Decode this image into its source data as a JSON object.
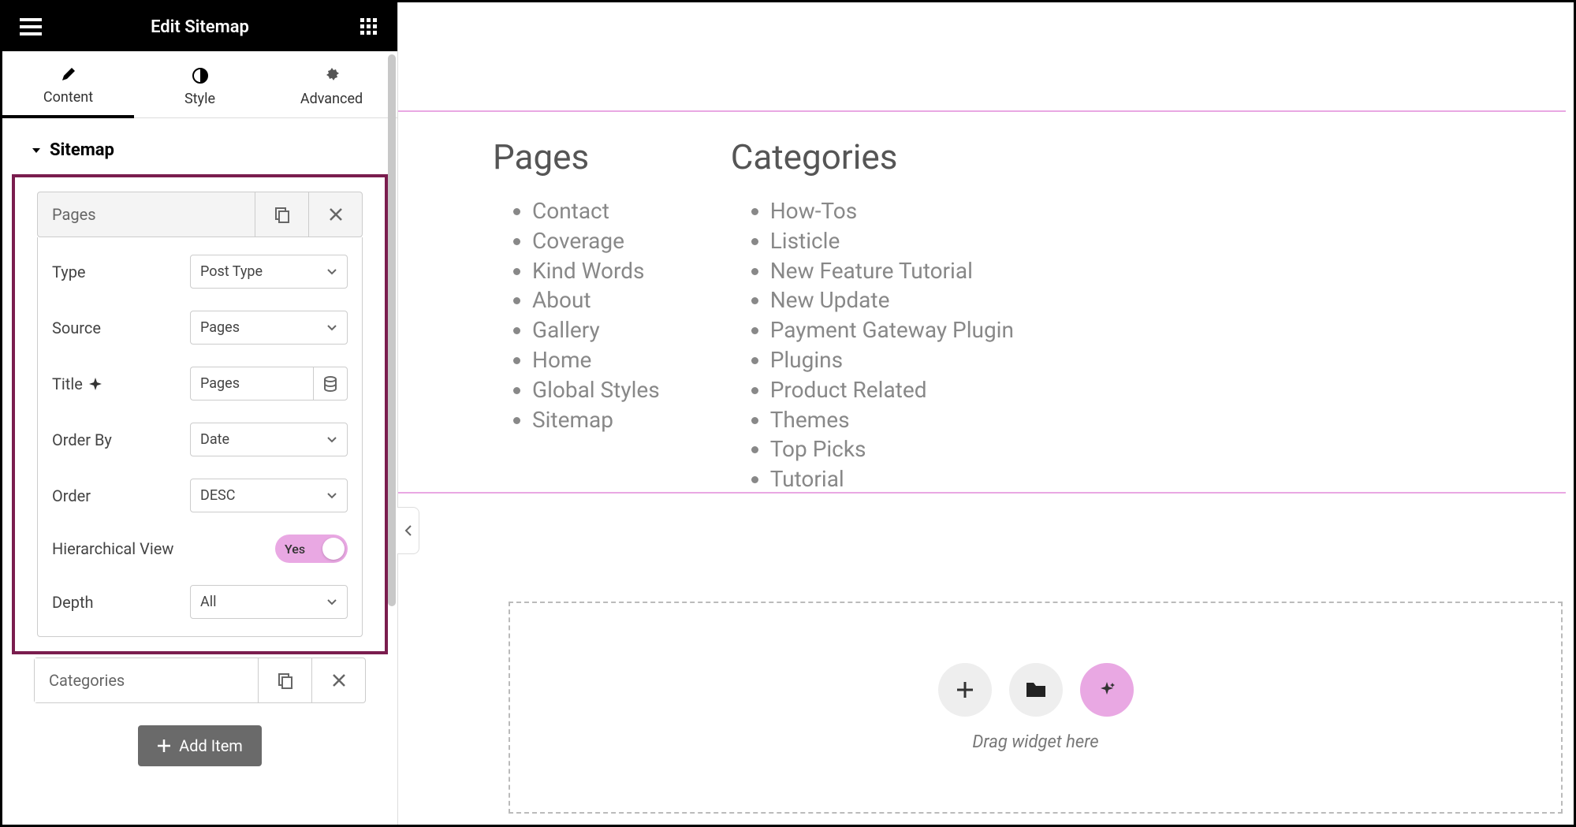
{
  "header": {
    "title": "Edit Sitemap"
  },
  "tabs": {
    "content": "Content",
    "style": "Style",
    "advanced": "Advanced"
  },
  "section": {
    "title": "Sitemap"
  },
  "pages_block": {
    "title": "Pages",
    "type_label": "Type",
    "type_value": "Post Type",
    "source_label": "Source",
    "source_value": "Pages",
    "title_label": "Title",
    "title_value": "Pages",
    "orderby_label": "Order By",
    "orderby_value": "Date",
    "order_label": "Order",
    "order_value": "DESC",
    "hier_label": "Hierarchical View",
    "hier_value": "Yes",
    "depth_label": "Depth",
    "depth_value": "All"
  },
  "categories_block": {
    "title": "Categories"
  },
  "add_item": "Add Item",
  "preview": {
    "pages_heading": "Pages",
    "categories_heading": "Categories",
    "pages": [
      "Contact",
      "Coverage",
      "Kind Words",
      "About",
      "Gallery",
      "Home",
      "Global Styles",
      "Sitemap"
    ],
    "categories": [
      "How-Tos",
      "Listicle",
      "New Feature Tutorial",
      "New Update",
      "Payment Gateway Plugin",
      "Plugins",
      "Product Related",
      "Themes",
      "Top Picks",
      "Tutorial"
    ]
  },
  "drop": {
    "text": "Drag widget here"
  }
}
